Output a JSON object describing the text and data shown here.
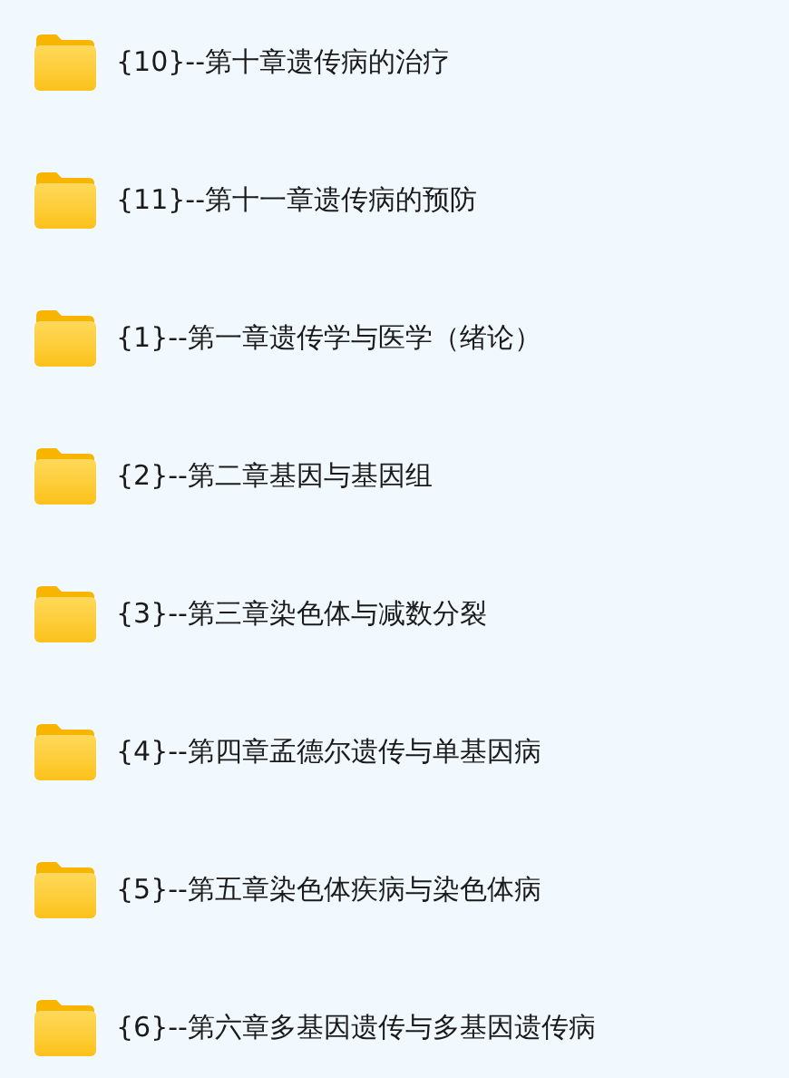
{
  "folders": [
    {
      "name": "{10}--第十章遗传病的治疗"
    },
    {
      "name": "{11}--第十一章遗传病的预防"
    },
    {
      "name": "{1}--第一章遗传学与医学（绪论）"
    },
    {
      "name": "{2}--第二章基因与基因组"
    },
    {
      "name": "{3}--第三章染色体与减数分裂"
    },
    {
      "name": "{4}--第四章孟德尔遗传与单基因病"
    },
    {
      "name": "{5}--第五章染色体疾病与染色体病"
    },
    {
      "name": "{6}--第六章多基因遗传与多基因遗传病"
    }
  ]
}
